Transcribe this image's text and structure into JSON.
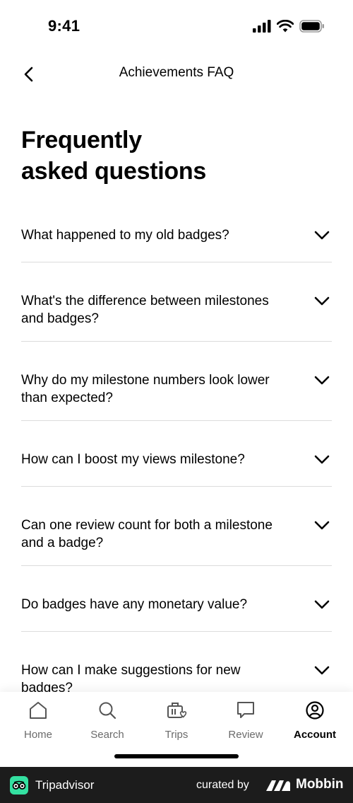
{
  "status_bar": {
    "time": "9:41"
  },
  "nav": {
    "title": "Achievements FAQ"
  },
  "page": {
    "title_line1": "Frequently",
    "title_line2": "asked questions"
  },
  "faq": [
    {
      "question": "What happened to my old badges?"
    },
    {
      "question": "What's the difference between milestones and badges?"
    },
    {
      "question": "Why do my milestone numbers look lower than expected?"
    },
    {
      "question": "How can I boost my views milestone?"
    },
    {
      "question": "Can one review count for both a milestone and a badge?"
    },
    {
      "question": "Do badges have any monetary value?"
    },
    {
      "question": "How can I make suggestions for new badges?"
    }
  ],
  "tabs": [
    {
      "label": "Home",
      "icon": "home-icon"
    },
    {
      "label": "Search",
      "icon": "search-icon"
    },
    {
      "label": "Trips",
      "icon": "trips-icon"
    },
    {
      "label": "Review",
      "icon": "review-icon"
    },
    {
      "label": "Account",
      "icon": "account-icon",
      "active": true
    }
  ],
  "footer": {
    "brand": "Tripadvisor",
    "curated_by": "curated by",
    "mobbin": "Mobbin"
  },
  "colors": {
    "accent": "#34e0a1",
    "divider": "#dcdcdc",
    "footer_bg": "#1c1c1c"
  }
}
